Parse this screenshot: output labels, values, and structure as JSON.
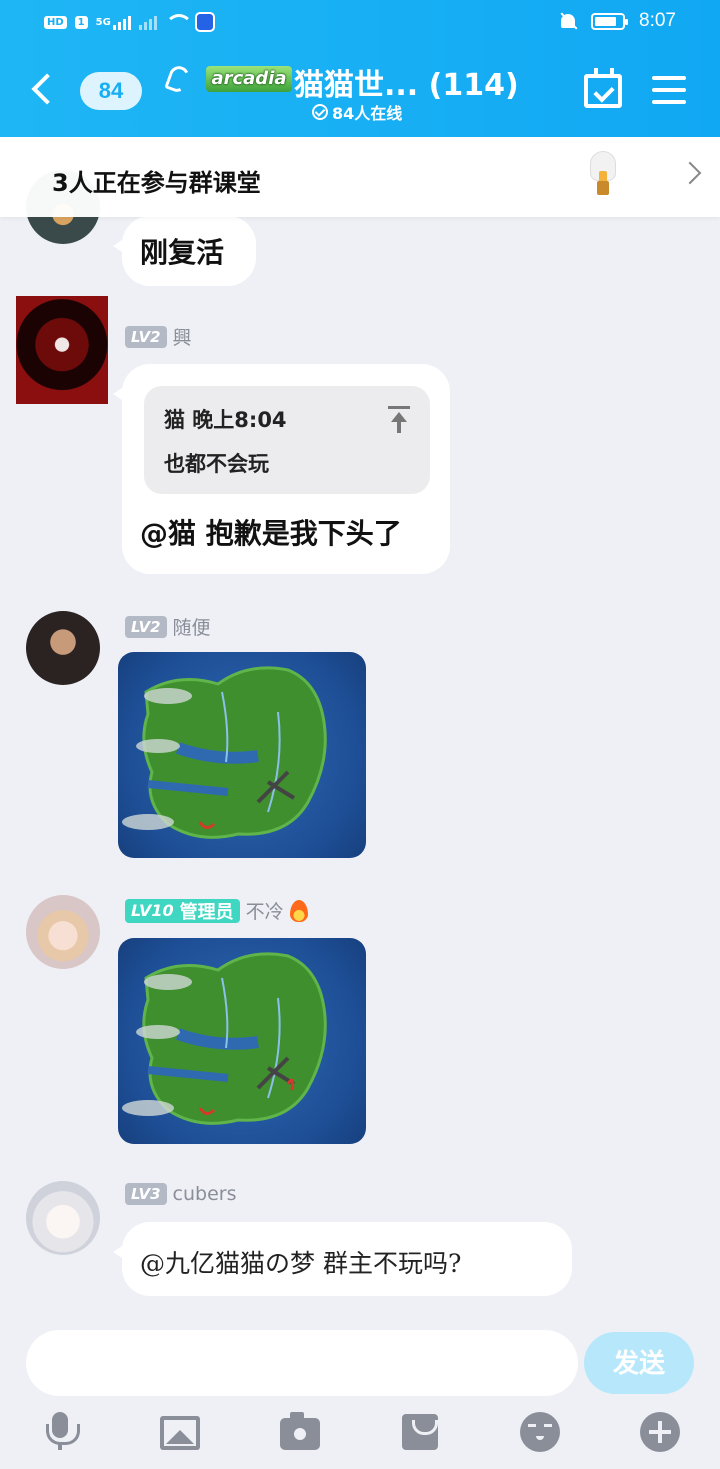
{
  "status_bar": {
    "hd_badge": "HD",
    "sim_badge": "1",
    "network": "5G",
    "time": "8:07"
  },
  "header": {
    "unread_count": "84",
    "logo_text": "arcadia",
    "title": "猫猫世... (114)",
    "online_text": "84人在线"
  },
  "banner": {
    "text": "3人正在参与群课堂"
  },
  "messages": [
    {
      "text": "刚复活"
    },
    {
      "level": "LV2",
      "sender": "興",
      "quote_meta": "猫 晚上8:04",
      "quote_text": "也都不会玩",
      "text": "@猫 抱歉是我下头了"
    },
    {
      "level": "LV2",
      "sender": "随便",
      "image": "island-map"
    },
    {
      "level": "LV10",
      "role": "管理员",
      "sender": "不冷",
      "image": "island-map"
    },
    {
      "level": "LV3",
      "sender": "cubers",
      "text": "@九亿猫猫の梦 群主不玩吗?"
    }
  ],
  "composer": {
    "input_value": "",
    "send_label": "发送"
  },
  "toolbar": [
    "mic-icon",
    "image-icon",
    "camera-icon",
    "red-envelope-icon",
    "emoji-icon",
    "plus-icon"
  ]
}
